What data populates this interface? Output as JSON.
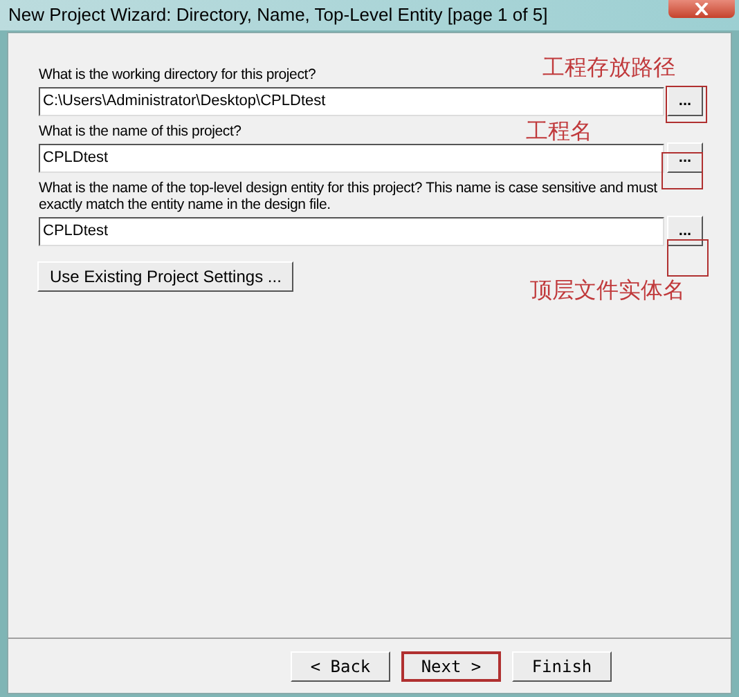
{
  "window": {
    "title": "New Project Wizard: Directory, Name, Top-Level Entity [page 1 of 5]"
  },
  "fields": [
    {
      "label": "What is the working directory for this project?",
      "value": "C:\\Users\\Administrator\\Desktop\\CPLDtest",
      "browse": "...",
      "annotation": "工程存放路径"
    },
    {
      "label": "What is the name of this project?",
      "value": "CPLDtest",
      "browse": "...",
      "annotation": "工程名"
    },
    {
      "label": "What is the name of the top-level design entity for this project? This name is case sensitive and must exactly match the entity name in the design file.",
      "value": "CPLDtest",
      "browse": "...",
      "annotation": "顶层文件实体名"
    }
  ],
  "settings_button": "Use Existing Project Settings ...",
  "buttons": [
    {
      "label": "< Back",
      "highlighted": false
    },
    {
      "label": "Next >",
      "highlighted": true
    },
    {
      "label": "Finish",
      "highlighted": false
    }
  ]
}
